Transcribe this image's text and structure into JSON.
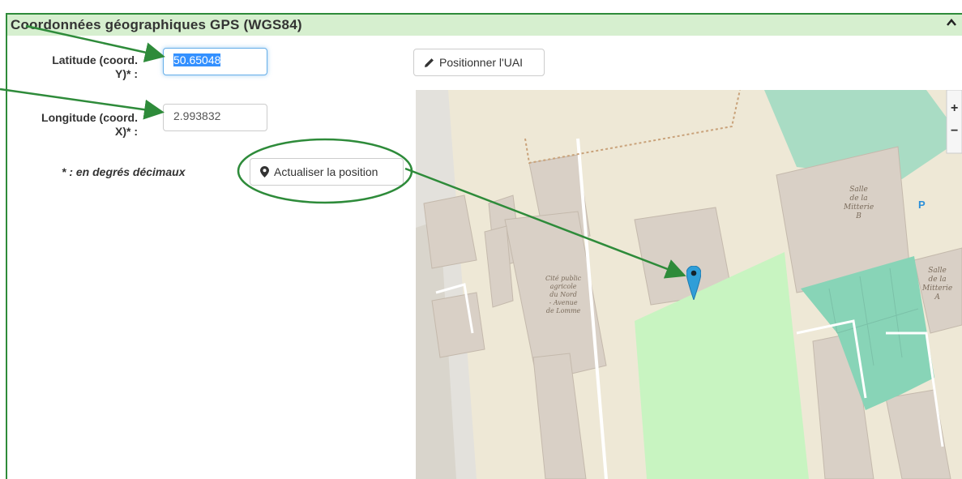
{
  "panel": {
    "title": "Coordonnées géographiques GPS (WGS84)",
    "header_color": "#d6efcf",
    "border_color": "#2e8b3a"
  },
  "form": {
    "latitude_label_line1": "Latitude (coord.",
    "latitude_label_line2": "Y)* :",
    "latitude_value": "50.65048",
    "longitude_label_line1": "Longitude (coord.",
    "longitude_label_line2": "X)* :",
    "longitude_value": "2.993832",
    "note": "* : en degrés décimaux",
    "update_button": "Actualiser la position",
    "update_icon": "map-marker-icon"
  },
  "map_panel": {
    "position_button": "Positionner l'UAI",
    "position_icon": "pencil-icon",
    "zoom_in": "+",
    "zoom_out": "−",
    "labels": {
      "salle_b": [
        "Salle",
        "de la",
        "Mitterie",
        "B"
      ],
      "salle_a": [
        "Salle",
        "de la",
        "Mitterie",
        "A"
      ],
      "lycee": [
        "Cité public",
        "agricole",
        "du Nord",
        "- Avenue",
        "de Lomme"
      ]
    },
    "marker_color": "#2f9ed8"
  },
  "annotation_color": "#2e8b3a"
}
